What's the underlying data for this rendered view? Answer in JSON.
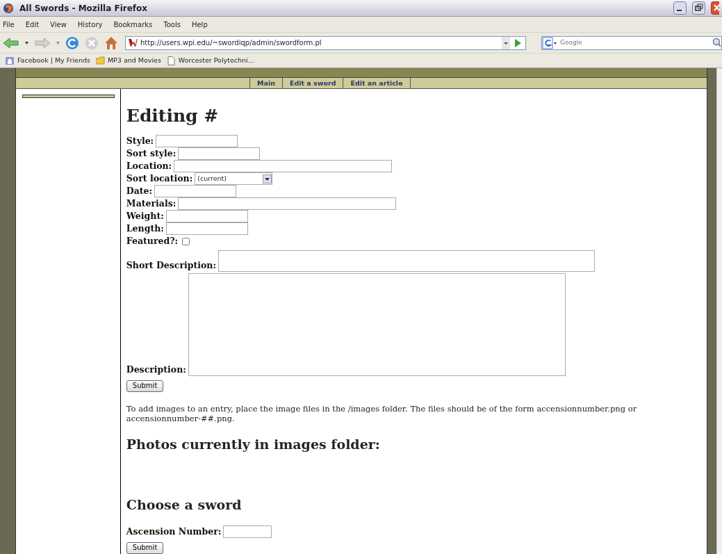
{
  "window": {
    "title": "All Swords - Mozilla Firefox"
  },
  "menu": [
    "File",
    "Edit",
    "View",
    "History",
    "Bookmarks",
    "Tools",
    "Help"
  ],
  "toolbar": {
    "url": "http://users.wpi.edu/~swordiqp/admin/swordform.pl",
    "search_placeholder": "Google"
  },
  "bookmarks": [
    {
      "label": "Facebook | My Friends",
      "kind": "site"
    },
    {
      "label": "MP3 and Movies",
      "kind": "folder"
    },
    {
      "label": "Worcester Polytechni…",
      "kind": "page"
    }
  ],
  "site": {
    "nav": [
      "Main",
      "Edit a sword",
      "Edit an article"
    ]
  },
  "form": {
    "heading": "Editing #",
    "fields": [
      {
        "label": "Style:",
        "kind": "text"
      },
      {
        "label": "Sort style:",
        "kind": "text"
      },
      {
        "label": "Location:",
        "kind": "long-text"
      },
      {
        "label": "Sort location:",
        "kind": "select",
        "value": "(current)"
      },
      {
        "label": "Date:",
        "kind": "text"
      },
      {
        "label": "Materials:",
        "kind": "long-text"
      },
      {
        "label": "Weight:",
        "kind": "text"
      },
      {
        "label": "Length:",
        "kind": "text"
      },
      {
        "label": "Featured?:",
        "kind": "checkbox",
        "checked": false
      },
      {
        "label": "Short Description:",
        "kind": "line"
      },
      {
        "label": "Description:",
        "kind": "textarea"
      }
    ],
    "submit": "Submit"
  },
  "note": "To add images to an entry, place the image files in the /images folder. The files should be of the form accensionnumber.png or accensionnumber-##.png.",
  "photos_heading": "Photos currently in images folder:",
  "choose": {
    "heading": "Choose a sword",
    "label": "Ascension Number:",
    "submit": "Submit"
  }
}
